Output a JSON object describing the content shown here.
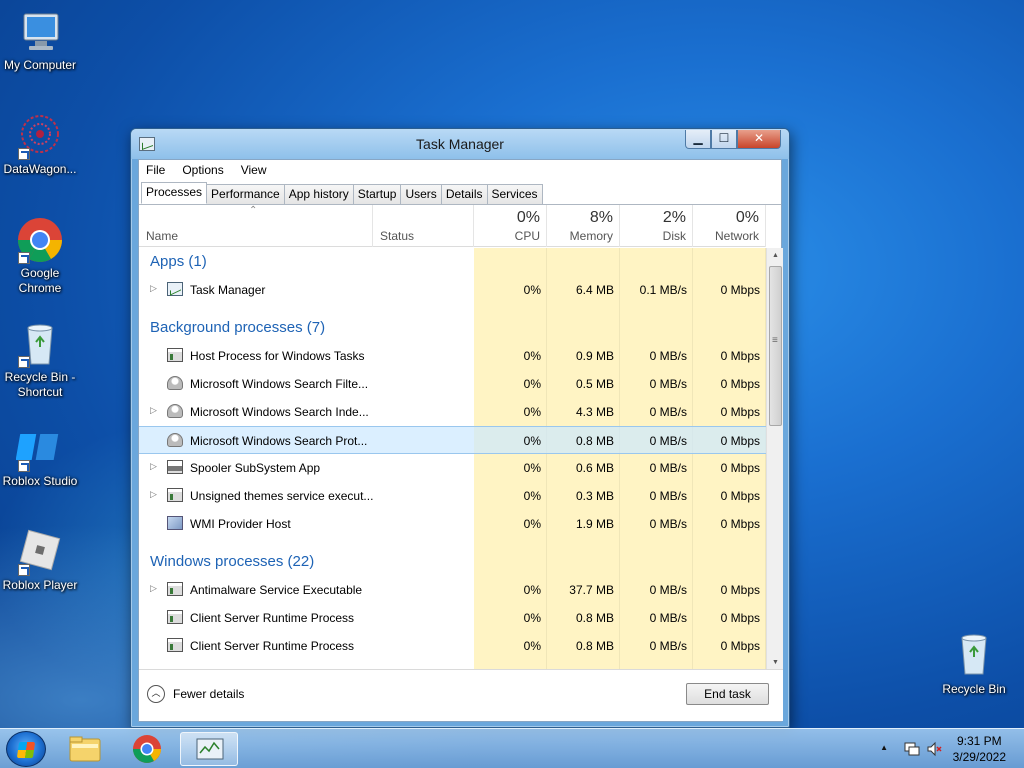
{
  "desktop": {
    "icons": [
      {
        "label": "My Computer"
      },
      {
        "label": "DataWagon..."
      },
      {
        "label": "Google Chrome"
      },
      {
        "label": "Recycle Bin - Shortcut"
      },
      {
        "label": "Roblox Studio"
      },
      {
        "label": "Roblox Player"
      },
      {
        "label": "Recycle Bin"
      }
    ]
  },
  "window": {
    "title": "Task Manager",
    "controls": {
      "minimize": "▁",
      "maximize": "☐",
      "close": "✕"
    },
    "menu": [
      "File",
      "Options",
      "View"
    ],
    "tabs": [
      "Processes",
      "Performance",
      "App history",
      "Startup",
      "Users",
      "Details",
      "Services"
    ],
    "active_tab": "Processes"
  },
  "table": {
    "headers": {
      "name": "Name",
      "status": "Status",
      "cpu": {
        "pct": "0%",
        "label": "CPU"
      },
      "memory": {
        "pct": "8%",
        "label": "Memory"
      },
      "disk": {
        "pct": "2%",
        "label": "Disk"
      },
      "network": {
        "pct": "0%",
        "label": "Network"
      }
    },
    "groups": [
      {
        "title": "Apps (1)"
      },
      {
        "title": "Background processes (7)"
      },
      {
        "title": "Windows processes (22)"
      }
    ],
    "rows": [
      {
        "name": "Task Manager",
        "cpu": "0%",
        "memory": "6.4 MB",
        "disk": "0.1 MB/s",
        "network": "0 Mbps"
      },
      {
        "name": "Host Process for Windows Tasks",
        "cpu": "0%",
        "memory": "0.9 MB",
        "disk": "0 MB/s",
        "network": "0 Mbps"
      },
      {
        "name": "Microsoft Windows Search Filte...",
        "cpu": "0%",
        "memory": "0.5 MB",
        "disk": "0 MB/s",
        "network": "0 Mbps"
      },
      {
        "name": "Microsoft Windows Search Inde...",
        "cpu": "0%",
        "memory": "4.3 MB",
        "disk": "0 MB/s",
        "network": "0 Mbps"
      },
      {
        "name": "Microsoft Windows Search Prot...",
        "cpu": "0%",
        "memory": "0.8 MB",
        "disk": "0 MB/s",
        "network": "0 Mbps"
      },
      {
        "name": "Spooler SubSystem App",
        "cpu": "0%",
        "memory": "0.6 MB",
        "disk": "0 MB/s",
        "network": "0 Mbps"
      },
      {
        "name": "Unsigned themes service execut...",
        "cpu": "0%",
        "memory": "0.3 MB",
        "disk": "0 MB/s",
        "network": "0 Mbps"
      },
      {
        "name": "WMI Provider Host",
        "cpu": "0%",
        "memory": "1.9 MB",
        "disk": "0 MB/s",
        "network": "0 Mbps"
      },
      {
        "name": "Antimalware Service Executable",
        "cpu": "0%",
        "memory": "37.7 MB",
        "disk": "0 MB/s",
        "network": "0 Mbps"
      },
      {
        "name": "Client Server Runtime Process",
        "cpu": "0%",
        "memory": "0.8 MB",
        "disk": "0 MB/s",
        "network": "0 Mbps"
      },
      {
        "name": "Client Server Runtime Process",
        "cpu": "0%",
        "memory": "0.8 MB",
        "disk": "0 MB/s",
        "network": "0 Mbps"
      }
    ]
  },
  "footer": {
    "fewer_details": "Fewer details",
    "end_task": "End task"
  },
  "taskbar": {
    "time": "9:31 PM",
    "date": "3/29/2022"
  }
}
